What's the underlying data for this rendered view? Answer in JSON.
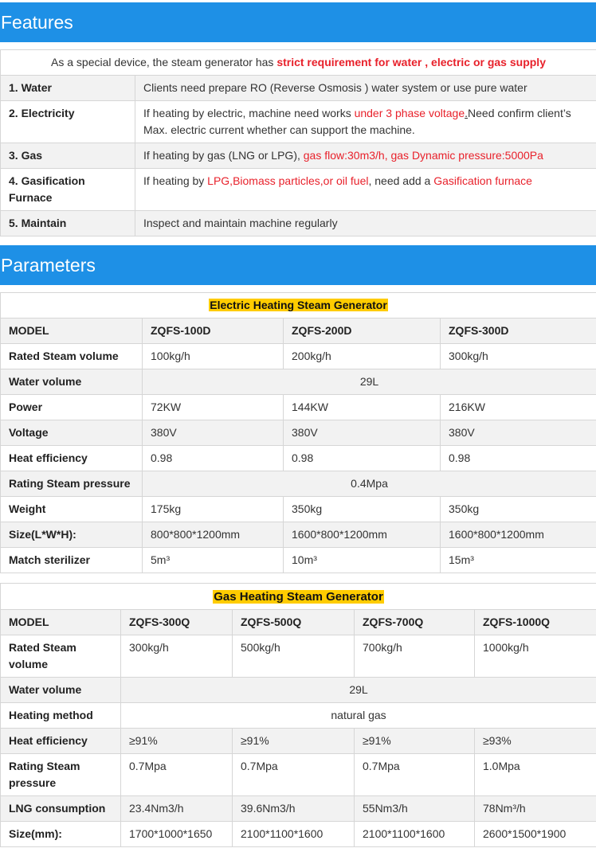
{
  "features": {
    "title": "Features",
    "intro_prefix": "As a special device, the steam generator has ",
    "intro_highlight": "strict requirement for water , electric or gas supply",
    "rows": {
      "water": {
        "label": "1. Water",
        "text": "Clients need prepare RO (Reverse Osmosis ) water system or use pure water"
      },
      "electricity": {
        "label": "2. Electricity",
        "text_a": "If heating by electric, machine need works ",
        "text_red": "under 3 phase voltage",
        "text_b": ".",
        "text_c": "Need confirm client’s Max. electric current whether can support the machine."
      },
      "gas": {
        "label": "3. Gas",
        "text_a": "If heating by gas (LNG or LPG), ",
        "text_red": "gas flow:30m3/h, gas Dynamic pressure:5000Pa"
      },
      "gasification": {
        "label": "4. Gasification Furnace",
        "text_a": "If heating by ",
        "text_red": "LPG,Biomass particles,or oil fuel",
        "text_b": ", need add a ",
        "text_red2": "Gasification furnace"
      },
      "maintain": {
        "label": "5. Maintain",
        "text": "Inspect and maintain machine regularly"
      }
    }
  },
  "parameters": {
    "title": "Parameters",
    "electric": {
      "title": "Electric Heating Steam Generator",
      "model_label": "MODEL",
      "models": [
        "ZQFS-100D",
        "ZQFS-200D",
        "ZQFS-300D"
      ],
      "rated_label": "Rated Steam volume",
      "rated": [
        "100kg/h",
        "200kg/h",
        "300kg/h"
      ],
      "water_label": "Water volume",
      "water": "29L",
      "power_label": "Power",
      "power": [
        "72KW",
        "144KW",
        "216KW"
      ],
      "voltage_label": "Voltage",
      "voltage": [
        "380V",
        "380V",
        "380V"
      ],
      "eff_label": "Heat efficiency",
      "eff": [
        "0.98",
        "0.98",
        "0.98"
      ],
      "pressure_label": "Rating Steam pressure",
      "pressure": "0.4Mpa",
      "weight_label": "Weight",
      "weight": [
        "175kg",
        "350kg",
        "350kg"
      ],
      "size_label": "Size(L*W*H):",
      "size": [
        "800*800*1200mm",
        "1600*800*1200mm",
        "1600*800*1200mm"
      ],
      "steril_label": "Match sterilizer",
      "steril": [
        "5m³",
        "10m³",
        "15m³"
      ]
    },
    "gas": {
      "title": "Gas Heating Steam Generator",
      "model_label": "MODEL",
      "models": [
        "ZQFS-300Q",
        "ZQFS-500Q",
        "ZQFS-700Q",
        "ZQFS-1000Q"
      ],
      "rated_label": "Rated Steam volume",
      "rated": [
        "300kg/h",
        "500kg/h",
        "700kg/h",
        "1000kg/h"
      ],
      "water_label": "Water volume",
      "water": "29L",
      "method_label": "Heating method",
      "method": "natural gas",
      "eff_label": "Heat efficiency",
      "eff": [
        "≥91%",
        "≥91%",
        "≥91%",
        "≥93%"
      ],
      "pressure_label": "Rating Steam pressure",
      "pressure": [
        "0.7Mpa",
        "0.7Mpa",
        "0.7Mpa",
        "1.0Mpa"
      ],
      "lng_label": "LNG consumption",
      "lng": [
        "23.4Nm3/h",
        "39.6Nm3/h",
        "55Nm3/h",
        "78Nm³/h"
      ],
      "size_label": "Size(mm):",
      "size": [
        "1700*1000*1650",
        "2100*1100*1600",
        "2100*1100*1600",
        "2600*1500*1900"
      ]
    }
  }
}
